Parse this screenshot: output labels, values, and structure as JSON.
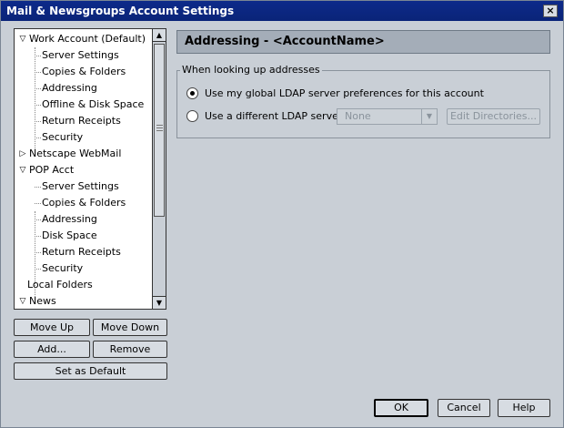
{
  "window": {
    "title": "Mail & Newsgroups Account Settings",
    "close_glyph": "×"
  },
  "tree": {
    "items": [
      {
        "label": "Work Account (Default)",
        "twisty": "▽"
      },
      {
        "label": "Server Settings"
      },
      {
        "label": "Copies & Folders"
      },
      {
        "label": "Addressing"
      },
      {
        "label": "Offline & Disk Space"
      },
      {
        "label": "Return Receipts"
      },
      {
        "label": "Security"
      },
      {
        "label": "Netscape WebMail",
        "twisty": "▷"
      },
      {
        "label": "POP Acct",
        "twisty": "▽"
      },
      {
        "label": "Server Settings"
      },
      {
        "label": "Copies & Folders"
      },
      {
        "label": "Addressing"
      },
      {
        "label": "Disk Space"
      },
      {
        "label": "Return Receipts"
      },
      {
        "label": "Security"
      },
      {
        "label": "Local Folders"
      },
      {
        "label": "News",
        "twisty": "▽"
      }
    ],
    "scroll_up_glyph": "▲",
    "scroll_down_glyph": "▼"
  },
  "buttons": {
    "move_up": "Move Up",
    "move_down": "Move Down",
    "add": "Add...",
    "remove": "Remove",
    "set_default": "Set as Default",
    "ok": "OK",
    "cancel": "Cancel",
    "help": "Help"
  },
  "panel": {
    "header": "Addressing - <AccountName>",
    "group_label": "When looking up addresses",
    "option_global": "Use my global LDAP server preferences for this account",
    "option_different": "Use a different LDAP server:",
    "ldap_select_value": "None",
    "edit_directories": "Edit Directories...",
    "select_arrow": "▼"
  }
}
